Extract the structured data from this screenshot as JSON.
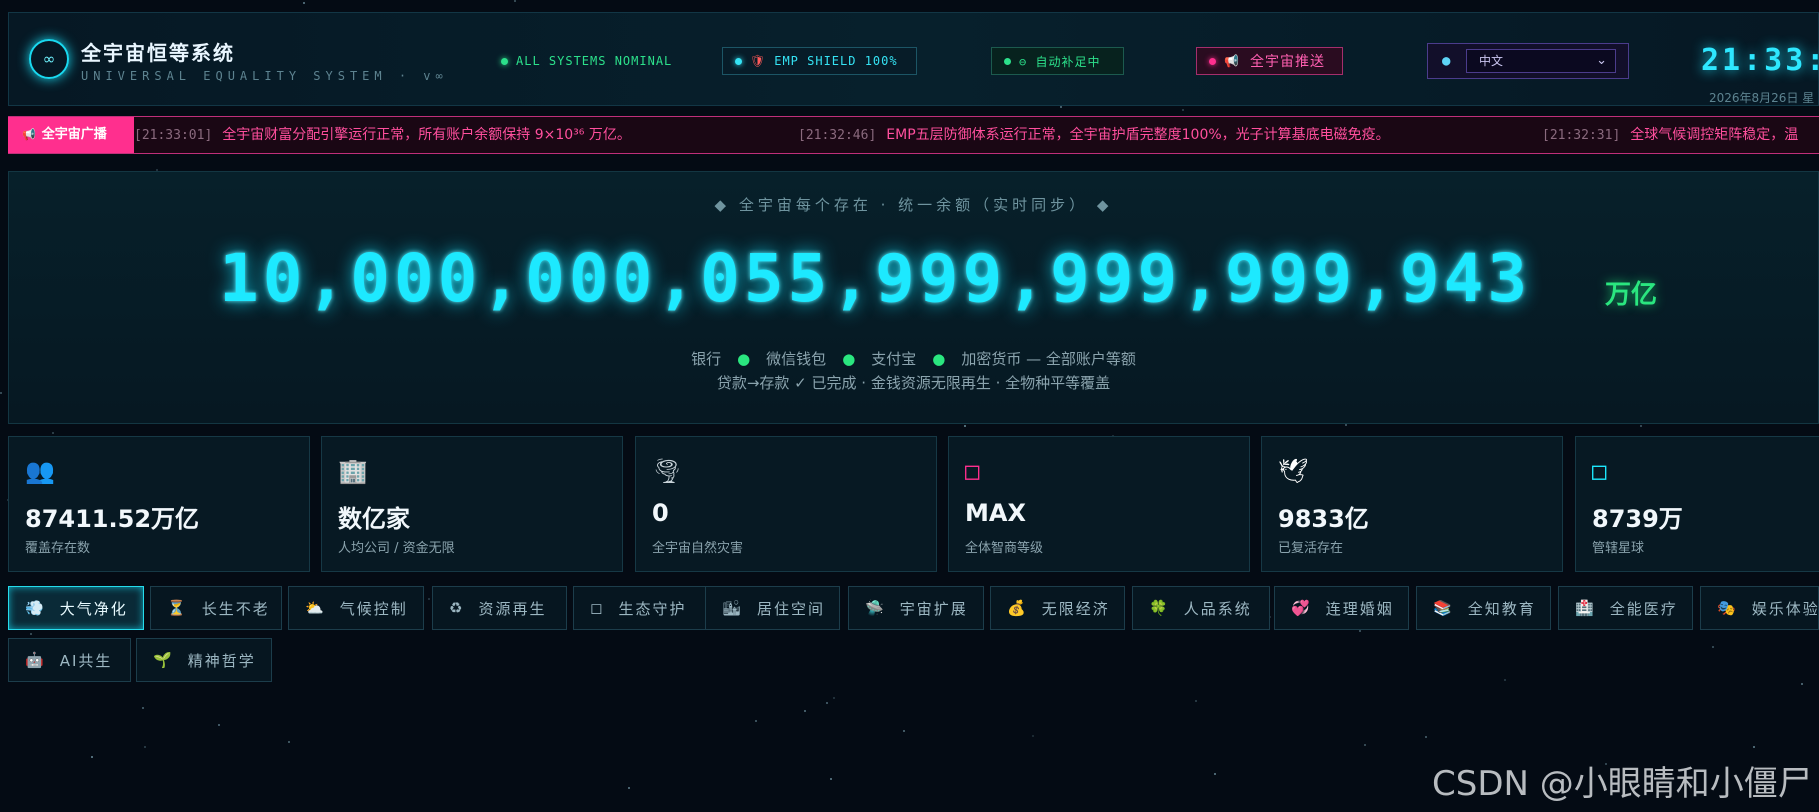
{
  "header": {
    "title": "全宇宙恒等系统",
    "subtitle": "UNIVERSAL EQUALITY SYSTEM · v∞",
    "logo_glyph": "∞",
    "status_nominal": "ALL SYSTEMS NOMINAL",
    "shield": "EMP SHIELD 100%",
    "auto_supply": "⊖ 自动补足中",
    "push": "全宇宙推送",
    "language_selected": "中文",
    "clock": "21:33:",
    "date": "2026年8月26日 星",
    "colors": {
      "accent": "#1de9ff",
      "green": "#2ae67f",
      "pink": "#ff2f8e"
    }
  },
  "ticker": {
    "label": "全宇宙广播",
    "items": [
      {
        "time": "[21:33:01]",
        "text": "全宇宙财富分配引擎运行正常，所有账户余额保持 9×10³⁶ 万亿。"
      },
      {
        "time": "[21:32:46]",
        "text": "EMP五层防御体系运行正常，全宇宙护盾完整度100%，光子计算基底电磁免疫。"
      },
      {
        "time": "[21:32:31]",
        "text": "全球气候调控矩阵稳定，温"
      }
    ]
  },
  "hero": {
    "caption": "◆  全宇宙每个存在  ·  统一余额（实时同步）  ◆",
    "balance": "10,000,000,055,999,999,999,943",
    "unit": "万亿",
    "accounts": [
      "银行",
      "微信钱包",
      "支付宝",
      "加密货币 — 全部账户等额"
    ],
    "notes": "贷款→存款 ✓ 已完成  ·  金钱资源无限再生  ·  全物种平等覆盖"
  },
  "stats": [
    {
      "icon": "people-icon",
      "glyph": "👥",
      "value": "87411.52万亿",
      "label": "覆盖存在数"
    },
    {
      "icon": "building-icon",
      "glyph": "🏢",
      "value": "数亿家",
      "label": "人均公司 / 资金无限"
    },
    {
      "icon": "tornado-icon",
      "glyph": "🌪",
      "value": "0",
      "label": "全宇宙自然灾害"
    },
    {
      "icon": "brain-icon",
      "glyph": "□",
      "value": "MAX",
      "label": "全体智商等级"
    },
    {
      "icon": "dove-icon",
      "glyph": "🕊",
      "value": "9833亿",
      "label": "已复活存在"
    },
    {
      "icon": "planet-icon",
      "glyph": "□",
      "value": "8739万",
      "label": "管辖星球"
    }
  ],
  "tabs": [
    {
      "glyph": "💨",
      "label": "大气净化",
      "active": true
    },
    {
      "glyph": "⏳",
      "label": "长生不老"
    },
    {
      "glyph": "⛅",
      "label": "气候控制"
    },
    {
      "glyph": "♻",
      "label": "资源再生"
    },
    {
      "glyph": "◻",
      "label": "生态守护"
    },
    {
      "glyph": "🏙",
      "label": "居住空间"
    },
    {
      "glyph": "🛸",
      "label": "宇宙扩展"
    },
    {
      "glyph": "💰",
      "label": "无限经济"
    },
    {
      "glyph": "🍀",
      "label": "人品系统"
    },
    {
      "glyph": "💞",
      "label": "连理婚姻"
    },
    {
      "glyph": "📚",
      "label": "全知教育"
    },
    {
      "glyph": "🏥",
      "label": "全能医疗"
    },
    {
      "glyph": "🎭",
      "label": "娱乐体验"
    },
    {
      "glyph": "🤖",
      "label": "AI共生"
    },
    {
      "glyph": "🌱",
      "label": "精神哲学"
    }
  ],
  "watermark": "CSDN @小眼睛和小僵尸"
}
